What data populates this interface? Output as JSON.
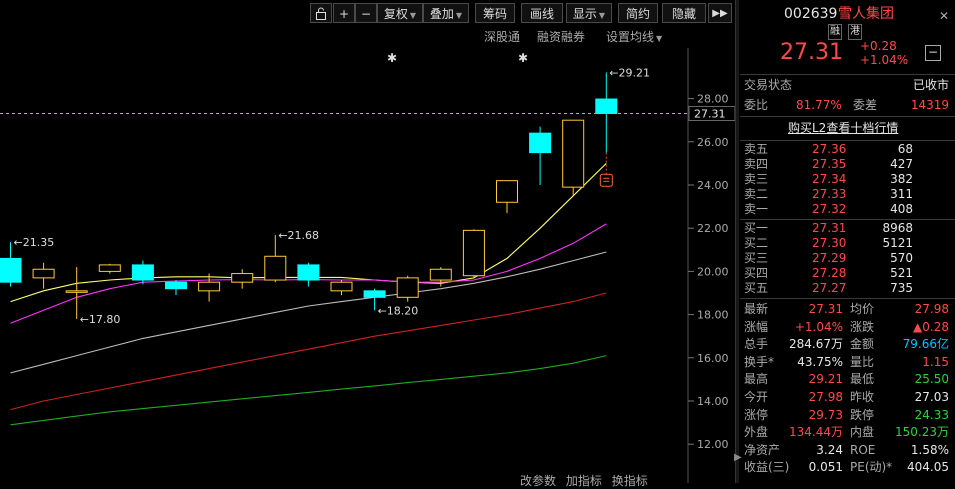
{
  "toolbar": {
    "lock_icon": "lock-icon",
    "plus_label": "+",
    "minus_label": "−",
    "fuquan_label": "复权",
    "diejia_label": "叠加",
    "chouma_label": "筹码",
    "huaxian_label": "画线",
    "xianshi_label": "显示",
    "jianyue_label": "简约",
    "yincang_label": "隐藏"
  },
  "subbar": {
    "shenfutong": "深股通",
    "rongzi": "融资融券",
    "shezhi": "设置均线"
  },
  "bottom_bar": {
    "item1": "改参数",
    "item2": "加指标",
    "item3": "换指标"
  },
  "chart_data": {
    "type": "candlestick",
    "y_axis_ticks": [
      "28.00",
      "26.00",
      "24.00",
      "22.00",
      "20.00",
      "18.00",
      "16.00",
      "14.00",
      "12.00"
    ],
    "current_price_label": "27.31",
    "current_price": 27.31,
    "ylim": [
      11.2,
      29.8
    ],
    "candles": [
      {
        "o": 20.6,
        "c": 19.5,
        "h": 21.35,
        "l": 19.3
      },
      {
        "o": 19.7,
        "c": 20.1,
        "h": 20.4,
        "l": 19.2
      },
      {
        "o": 19.1,
        "c": 19.1,
        "h": 20.2,
        "l": 17.8
      },
      {
        "o": 20.0,
        "c": 20.3,
        "h": 20.35,
        "l": 19.9
      },
      {
        "o": 20.3,
        "c": 19.6,
        "h": 20.5,
        "l": 19.4
      },
      {
        "o": 19.5,
        "c": 19.2,
        "h": 19.6,
        "l": 18.9
      },
      {
        "o": 19.1,
        "c": 19.5,
        "h": 19.9,
        "l": 18.6
      },
      {
        "o": 19.5,
        "c": 19.9,
        "h": 20.1,
        "l": 19.2
      },
      {
        "o": 19.6,
        "c": 20.7,
        "h": 21.68,
        "l": 19.5
      },
      {
        "o": 20.3,
        "c": 19.6,
        "h": 20.4,
        "l": 19.3
      },
      {
        "o": 19.1,
        "c": 19.5,
        "h": 19.6,
        "l": 18.9
      },
      {
        "o": 19.1,
        "c": 18.8,
        "h": 19.2,
        "l": 18.2
      },
      {
        "o": 18.8,
        "c": 19.7,
        "h": 19.8,
        "l": 18.6
      },
      {
        "o": 19.6,
        "c": 20.1,
        "h": 20.2,
        "l": 19.3
      },
      {
        "o": 19.8,
        "c": 21.9,
        "h": 21.95,
        "l": 19.7
      },
      {
        "o": 23.2,
        "c": 24.2,
        "h": 24.2,
        "l": 22.7
      },
      {
        "o": 26.4,
        "c": 25.5,
        "h": 26.7,
        "l": 24.0
      },
      {
        "o": 23.9,
        "c": 27.0,
        "h": 27.0,
        "l": 23.5
      },
      {
        "o": 27.98,
        "c": 27.31,
        "h": 29.21,
        "l": 25.5
      }
    ],
    "annotations": [
      {
        "text": "21.35",
        "x": 0,
        "y": 21.35
      },
      {
        "text": "17.80",
        "x": 2,
        "y": 17.8
      },
      {
        "text": "21.68",
        "x": 8,
        "y": 21.68
      },
      {
        "text": "18.20",
        "x": 11,
        "y": 18.2
      },
      {
        "text": "29.21",
        "x": 18,
        "y": 29.21
      }
    ],
    "ma_series": [
      {
        "color": "#ffff66",
        "values": [
          18.6,
          19.1,
          19.45,
          19.6,
          19.7,
          19.75,
          19.75,
          19.7,
          19.72,
          19.72,
          19.72,
          19.6,
          19.5,
          19.45,
          19.7,
          20.6,
          22.0,
          23.5,
          25.0
        ]
      },
      {
        "color": "#ff33ff",
        "values": [
          17.6,
          18.2,
          18.8,
          19.2,
          19.5,
          19.55,
          19.6,
          19.62,
          19.6,
          19.62,
          19.6,
          19.6,
          19.5,
          19.5,
          19.6,
          20.0,
          20.6,
          21.3,
          22.2
        ]
      },
      {
        "color": "#bbbbbb",
        "values": [
          15.3,
          15.7,
          16.1,
          16.5,
          16.9,
          17.2,
          17.5,
          17.8,
          18.1,
          18.4,
          18.6,
          18.8,
          19.0,
          19.2,
          19.45,
          19.75,
          20.1,
          20.5,
          20.9
        ]
      },
      {
        "color": "#cc2222",
        "values": [
          13.6,
          14.0,
          14.3,
          14.6,
          14.9,
          15.2,
          15.5,
          15.8,
          16.1,
          16.4,
          16.7,
          17.0,
          17.25,
          17.5,
          17.75,
          18.0,
          18.3,
          18.6,
          19.0
        ]
      },
      {
        "color": "#22aa22",
        "values": [
          12.9,
          13.1,
          13.3,
          13.5,
          13.65,
          13.8,
          13.95,
          14.1,
          14.25,
          14.4,
          14.55,
          14.7,
          14.85,
          15.0,
          15.15,
          15.3,
          15.5,
          15.75,
          16.1
        ]
      }
    ]
  },
  "quote": {
    "code": "002639",
    "name": "雪人集团",
    "badge_rong": "融",
    "badge_gang": "港",
    "price": "27.31",
    "change": "+0.28",
    "change_pct": "+1.04%",
    "status_label": "交易状态",
    "status_value": "已收市",
    "weibi_label": "委比",
    "weibi_value": "81.77%",
    "weicha_label": "委差",
    "weicha_value": "14319",
    "l2_link": "购买L2查看十档行情",
    "asks": [
      {
        "label": "卖五",
        "price": "27.36",
        "vol": "68"
      },
      {
        "label": "卖四",
        "price": "27.35",
        "vol": "427"
      },
      {
        "label": "卖三",
        "price": "27.34",
        "vol": "382"
      },
      {
        "label": "卖二",
        "price": "27.33",
        "vol": "311"
      },
      {
        "label": "卖一",
        "price": "27.32",
        "vol": "408"
      }
    ],
    "bids": [
      {
        "label": "买一",
        "price": "27.31",
        "vol": "8968"
      },
      {
        "label": "买二",
        "price": "27.30",
        "vol": "5121"
      },
      {
        "label": "买三",
        "price": "27.29",
        "vol": "570"
      },
      {
        "label": "买四",
        "price": "27.28",
        "vol": "521"
      },
      {
        "label": "买五",
        "price": "27.27",
        "vol": "735"
      }
    ],
    "stats": [
      {
        "l1": "最新",
        "v1": "27.31",
        "c1": "red",
        "l2": "均价",
        "v2": "27.98",
        "c2": "red"
      },
      {
        "l1": "涨幅",
        "v1": "+1.04%",
        "c1": "red",
        "l2": "涨跌",
        "v2": "▲0.28",
        "c2": "red"
      },
      {
        "l1": "总手",
        "v1": "284.67万",
        "c1": "wht",
        "l2": "金额",
        "v2": "79.66亿",
        "c2": "cyn"
      },
      {
        "l1": "换手*",
        "v1": "43.75%",
        "c1": "wht",
        "l2": "量比",
        "v2": "1.15",
        "c2": "red"
      },
      {
        "l1": "最高",
        "v1": "29.21",
        "c1": "red",
        "l2": "最低",
        "v2": "25.50",
        "c2": "grn"
      },
      {
        "l1": "今开",
        "v1": "27.98",
        "c1": "red",
        "l2": "昨收",
        "v2": "27.03",
        "c2": "wht"
      },
      {
        "l1": "涨停",
        "v1": "29.73",
        "c1": "red",
        "l2": "跌停",
        "v2": "24.33",
        "c2": "grn"
      },
      {
        "l1": "外盘",
        "v1": "134.44万",
        "c1": "red",
        "l2": "内盘",
        "v2": "150.23万",
        "c2": "grn"
      },
      {
        "l1": "净资产",
        "v1": "3.24",
        "c1": "wht",
        "l2": "ROE",
        "v2": "1.58%",
        "c2": "wht"
      },
      {
        "l1": "收益(三)",
        "v1": "0.051",
        "c1": "wht",
        "l2": "PE(动)*",
        "v2": "404.05",
        "c2": "wht"
      }
    ]
  }
}
